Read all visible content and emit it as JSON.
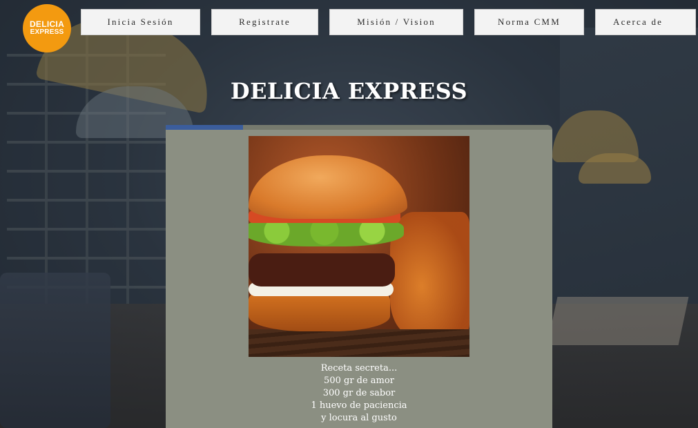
{
  "logo": {
    "line1": "DELICIA",
    "line2": "EXPRESS",
    "color": "#f39a10"
  },
  "nav": {
    "items": [
      {
        "label": "Inicia Sesión"
      },
      {
        "label": "Registrate"
      },
      {
        "label": "Misión / Vision"
      },
      {
        "label": "Norma CMM"
      },
      {
        "label": "Acerca de"
      }
    ]
  },
  "hero": {
    "title": "DELICIA EXPRESS"
  },
  "panel": {
    "progress": 0.2,
    "image_alt": "hamburger-photo",
    "recipe": [
      "Receta secreta...",
      "500 gr de amor",
      "300 gr de sabor",
      "1 huevo de paciencia",
      "y locura al gusto"
    ]
  },
  "colors": {
    "accent": "#3b5d9c",
    "panel": "#8b8f82",
    "nav_bg": "#f3f3f3"
  }
}
